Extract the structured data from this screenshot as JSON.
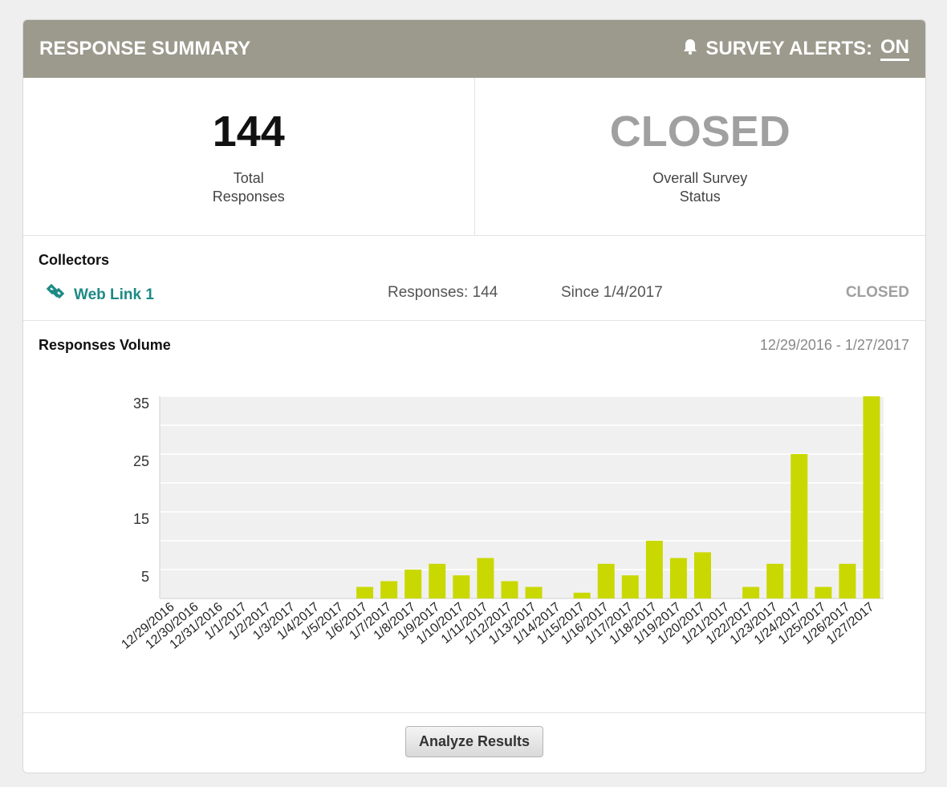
{
  "header": {
    "title": "RESPONSE SUMMARY",
    "alerts_label": "SURVEY ALERTS:",
    "alerts_state": "ON",
    "alerts_icon": "bell-icon"
  },
  "stats": {
    "total_value": "144",
    "total_label": "Total\nResponses",
    "status_value": "CLOSED",
    "status_label": "Overall Survey\nStatus"
  },
  "collectors": {
    "title": "Collectors",
    "items": [
      {
        "name": "Web Link 1",
        "icon": "link-icon",
        "responses": "Responses: 144",
        "since": "Since 1/4/2017",
        "status": "CLOSED"
      }
    ]
  },
  "volume": {
    "title": "Responses Volume",
    "range": "12/29/2016 - 1/27/2017"
  },
  "colors": {
    "header_bg": "#9b9a8d",
    "link": "#1d8a85",
    "bar": "#c9d800",
    "plot_bg": "#f0f0f0",
    "status_gray": "#a0a0a0"
  },
  "chart_data": {
    "type": "bar",
    "categories": [
      "12/29/2016",
      "12/30/2016",
      "12/31/2016",
      "1/1/2017",
      "1/2/2017",
      "1/3/2017",
      "1/4/2017",
      "1/5/2017",
      "1/6/2017",
      "1/7/2017",
      "1/8/2017",
      "1/9/2017",
      "1/10/2017",
      "1/11/2017",
      "1/12/2017",
      "1/13/2017",
      "1/14/2017",
      "1/15/2017",
      "1/16/2017",
      "1/17/2017",
      "1/18/2017",
      "1/19/2017",
      "1/20/2017",
      "1/21/2017",
      "1/22/2017",
      "1/23/2017",
      "1/24/2017",
      "1/25/2017",
      "1/26/2017",
      "1/27/2017"
    ],
    "values": [
      0,
      0,
      0,
      0,
      0,
      0,
      0,
      0,
      2,
      3,
      5,
      6,
      4,
      7,
      3,
      2,
      0,
      1,
      6,
      4,
      10,
      7,
      8,
      0,
      2,
      6,
      25,
      2,
      6,
      35
    ],
    "yticks": [
      5,
      15,
      25,
      35
    ],
    "ylim": [
      0,
      35
    ],
    "grid": true
  },
  "footer": {
    "analyze_label": "Analyze Results"
  }
}
